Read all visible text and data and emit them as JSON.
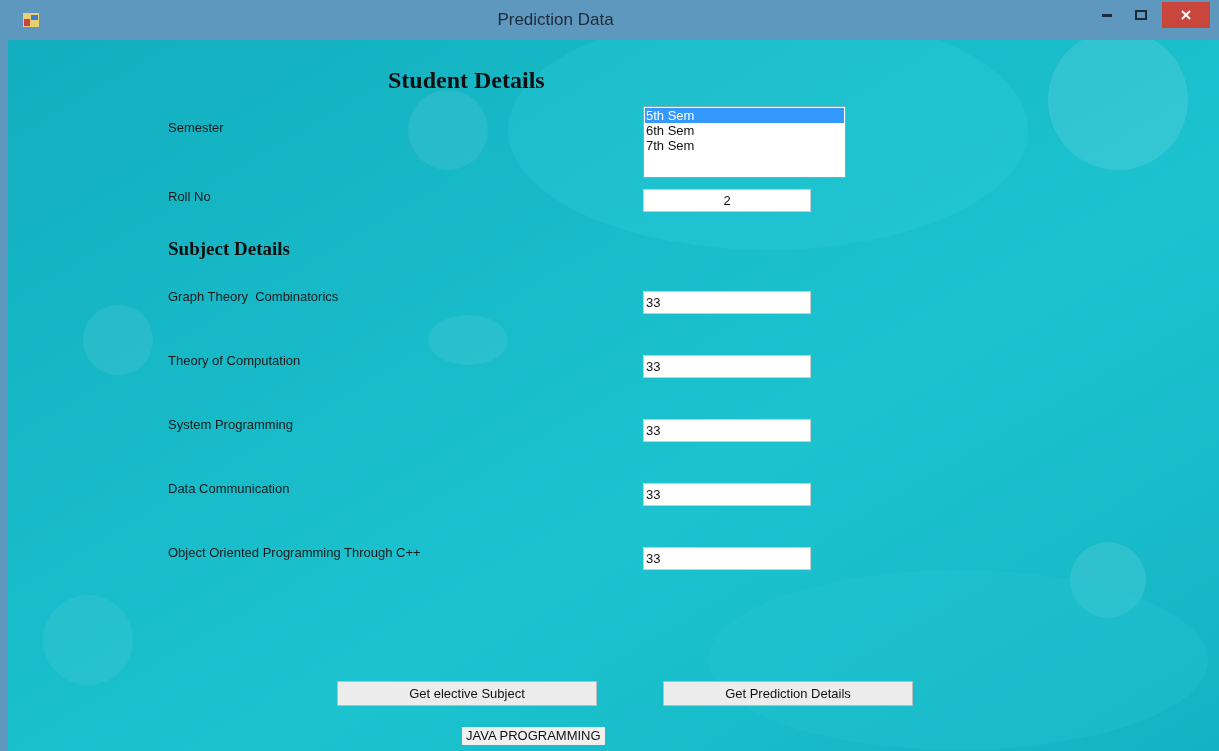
{
  "window": {
    "title": "Prediction Data"
  },
  "student_details": {
    "heading": "Student Details",
    "semester": {
      "label": "Semester",
      "options": [
        {
          "label": "5th Sem",
          "selected": true
        },
        {
          "label": "6th Sem",
          "selected": false
        },
        {
          "label": "7th Sem",
          "selected": false
        }
      ]
    },
    "roll_no": {
      "label": "Roll No",
      "value": "2"
    }
  },
  "subject_details": {
    "heading": "Subject Details",
    "subjects": [
      {
        "label": "Graph Theory  Combinatorics",
        "value": "33"
      },
      {
        "label": "Theory of Computation",
        "value": "33"
      },
      {
        "label": "System Programming",
        "value": "33"
      },
      {
        "label": "Data Communication",
        "value": "33"
      },
      {
        "label": "Object Oriented Programming Through C++",
        "value": "33"
      }
    ]
  },
  "buttons": [
    "Get elective Subject",
    "Get Prediction Details"
  ],
  "result": "JAVA PROGRAMMING"
}
